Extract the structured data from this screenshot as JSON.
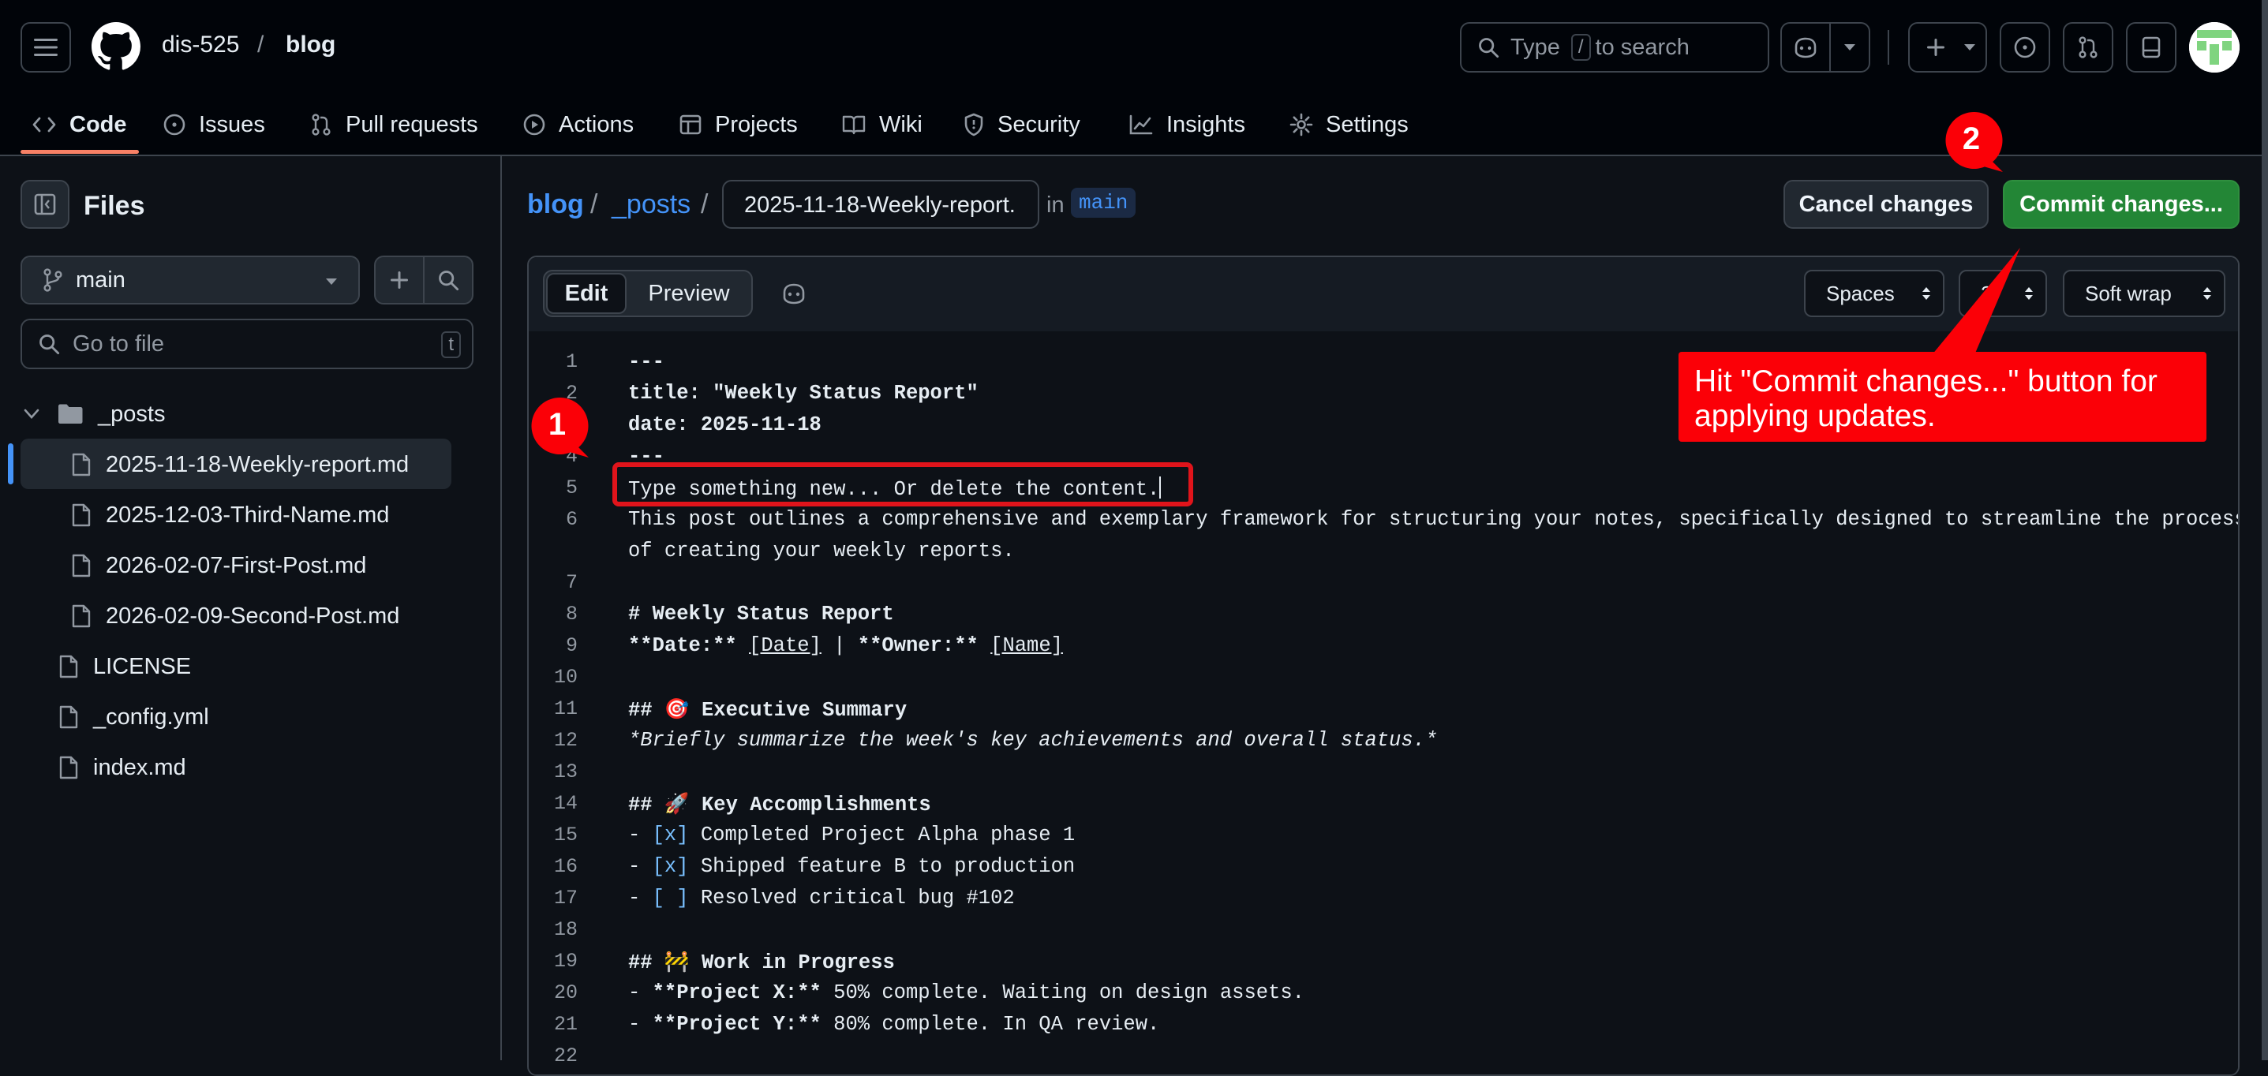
{
  "header": {
    "owner": "dis-525",
    "separator": "/",
    "repo": "blog",
    "search_prefix": "Type",
    "search_key": "/",
    "search_suffix": "to search"
  },
  "nav": {
    "tabs": [
      {
        "label": "Code",
        "icon": "code-icon",
        "active": true
      },
      {
        "label": "Issues",
        "icon": "issue-icon"
      },
      {
        "label": "Pull requests",
        "icon": "pull-request-icon"
      },
      {
        "label": "Actions",
        "icon": "play-icon"
      },
      {
        "label": "Projects",
        "icon": "table-icon"
      },
      {
        "label": "Wiki",
        "icon": "book-icon"
      },
      {
        "label": "Security",
        "icon": "shield-icon"
      },
      {
        "label": "Insights",
        "icon": "graph-icon"
      },
      {
        "label": "Settings",
        "icon": "gear-icon"
      }
    ]
  },
  "sidebar": {
    "title": "Files",
    "branch": "main",
    "goto_placeholder": "Go to file",
    "goto_key": "t",
    "tree": [
      {
        "label": "_posts",
        "type": "folder"
      },
      {
        "label": "2025-11-18-Weekly-report.md",
        "type": "file",
        "selected": true
      },
      {
        "label": "2025-12-03-Third-Name.md",
        "type": "file"
      },
      {
        "label": "2026-02-07-First-Post.md",
        "type": "file"
      },
      {
        "label": "2026-02-09-Second-Post.md",
        "type": "file"
      },
      {
        "label": "LICENSE",
        "type": "file"
      },
      {
        "label": "_config.yml",
        "type": "file"
      },
      {
        "label": "index.md",
        "type": "file"
      }
    ]
  },
  "breadcrumb": {
    "repo": "blog",
    "sep": "/",
    "folder": "_posts",
    "filename": "2025-11-18-Weekly-report.",
    "in_label": "in",
    "branch": "main"
  },
  "actions": {
    "cancel": "Cancel changes",
    "commit": "Commit changes..."
  },
  "editor": {
    "edit_tab": "Edit",
    "preview_tab": "Preview",
    "indent_mode": "Spaces",
    "indent_size": "2",
    "wrap_mode": "Soft wrap",
    "line_numbers": [
      "1",
      "2",
      "3",
      "4",
      "5",
      "6",
      "",
      "7",
      "8",
      "9",
      "10",
      "11",
      "12",
      "13",
      "14",
      "15",
      "16",
      "17",
      "18",
      "19",
      "20",
      "21",
      "22"
    ],
    "lines": {
      "l1": "---",
      "l2": "title: \"Weekly Status Report\"",
      "l3": "date: 2025-11-18",
      "l4": "---",
      "l5": "Type something new... Or delete the content.",
      "l6a": "This post outlines a comprehensive and exemplary framework for structuring your notes, specifically designed to streamline the process",
      "l6b": "of creating your weekly reports.",
      "l8": "# Weekly Status Report",
      "l9_date": "**Date:**",
      "l9_date_link": "[Date]",
      "l9_pipe": " | ",
      "l9_owner": "**Owner:**",
      "l9_owner_link": "[Name]",
      "l11_hash": "## ",
      "l11_emoji": "🎯",
      "l11_text": " Executive Summary",
      "l12": "*Briefly summarize the week's key achievements and overall status.*",
      "l14_hash": "## ",
      "l14_emoji": "🚀",
      "l14_text": " Key Accomplishments",
      "l15_dash": "- ",
      "l15_box": "[x]",
      "l15_text": " Completed Project Alpha phase 1",
      "l16_dash": "- ",
      "l16_box": "[x]",
      "l16_text": " Shipped feature B to production",
      "l17_dash": "- ",
      "l17_box": "[ ]",
      "l17_text": " Resolved critical bug #102",
      "l19_hash": "## ",
      "l19_emoji": "🚧",
      "l19_text": " Work in Progress",
      "l20_dash": "- ",
      "l20_bold": "**Project X:**",
      "l20_text": " 50% complete. Waiting on design assets.",
      "l21_dash": "- ",
      "l21_bold": "**Project Y:**",
      "l21_text": " 80% complete. In QA review."
    }
  },
  "annotations": {
    "step1": "1",
    "step2": "2",
    "callout": "Hit \"Commit changes...\" button for applying updates.",
    "color": "#fb0007"
  },
  "colors": {
    "accent_link": "#4493f8",
    "commit_green": "#238636",
    "active_tab_underline": "#f78166",
    "background": "#0d1117"
  }
}
